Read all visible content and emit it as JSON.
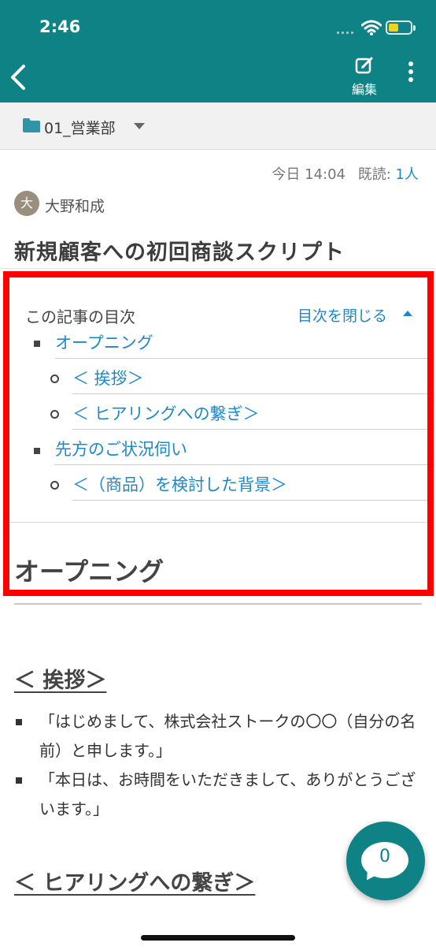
{
  "status_bar": {
    "time": "2:46"
  },
  "header": {
    "edit_label": "編集"
  },
  "folder": {
    "name": "01_営業部"
  },
  "post": {
    "date": "今日 14:04",
    "read_label": "既読:",
    "read_count": "1人",
    "author_initial": "大",
    "author": "大野和成",
    "title": "新規顧客への初回商談スクリプト"
  },
  "toc": {
    "heading": "この記事の目次",
    "toggle_label": "目次を閉じる",
    "items": [
      {
        "label": "オープニング",
        "level": 1
      },
      {
        "label": "＜ 挨拶＞",
        "level": 2
      },
      {
        "label": "＜ ヒアリングへの繋ぎ＞",
        "level": 2
      },
      {
        "label": "先方のご状況伺い",
        "level": 1
      },
      {
        "label": "＜（商品）を検討した背景＞",
        "level": 2
      }
    ]
  },
  "body": {
    "h1_opening": "オープニング",
    "h2_greeting": "＜ 挨拶＞",
    "greeting_lines": [
      "「はじめまして、株式会社ストークの〇〇（自分の名前）と申します。」",
      "「本日は、お時間をいただきまして、ありがとうございます。」"
    ],
    "h2_hearing": "＜ ヒアリングへの繋ぎ＞"
  },
  "comment_fab": {
    "count": "0"
  },
  "colors": {
    "header": "#0f8286",
    "link": "#1e88c7",
    "highlight": "#ff0000"
  }
}
